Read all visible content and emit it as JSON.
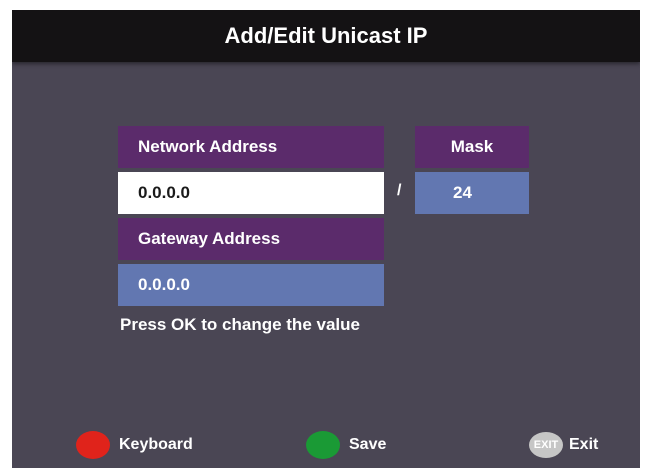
{
  "title": "Add/Edit Unicast IP",
  "network_address": {
    "label": "Network Address",
    "value": "0.0.0.0"
  },
  "separator": "/",
  "mask": {
    "label": "Mask",
    "value": "24"
  },
  "gateway_address": {
    "label": "Gateway Address",
    "value": "0.0.0.0"
  },
  "hint": "Press OK to change the value",
  "footer": {
    "keyboard": {
      "label": "Keyboard",
      "color": "#e0231b",
      "icon": "red-circle-icon"
    },
    "save": {
      "label": "Save",
      "color": "#1a9a35",
      "icon": "green-circle-icon"
    },
    "exit": {
      "label": "Exit",
      "badge": "EXIT",
      "color": "#c6c6c6",
      "icon": "exit-button-icon"
    }
  },
  "colors": {
    "background": "#4a4654",
    "title_bar": "#141214",
    "header_box": "#5b2b6b",
    "value_box": "#6277b1",
    "selected_box": "#ffffff"
  }
}
